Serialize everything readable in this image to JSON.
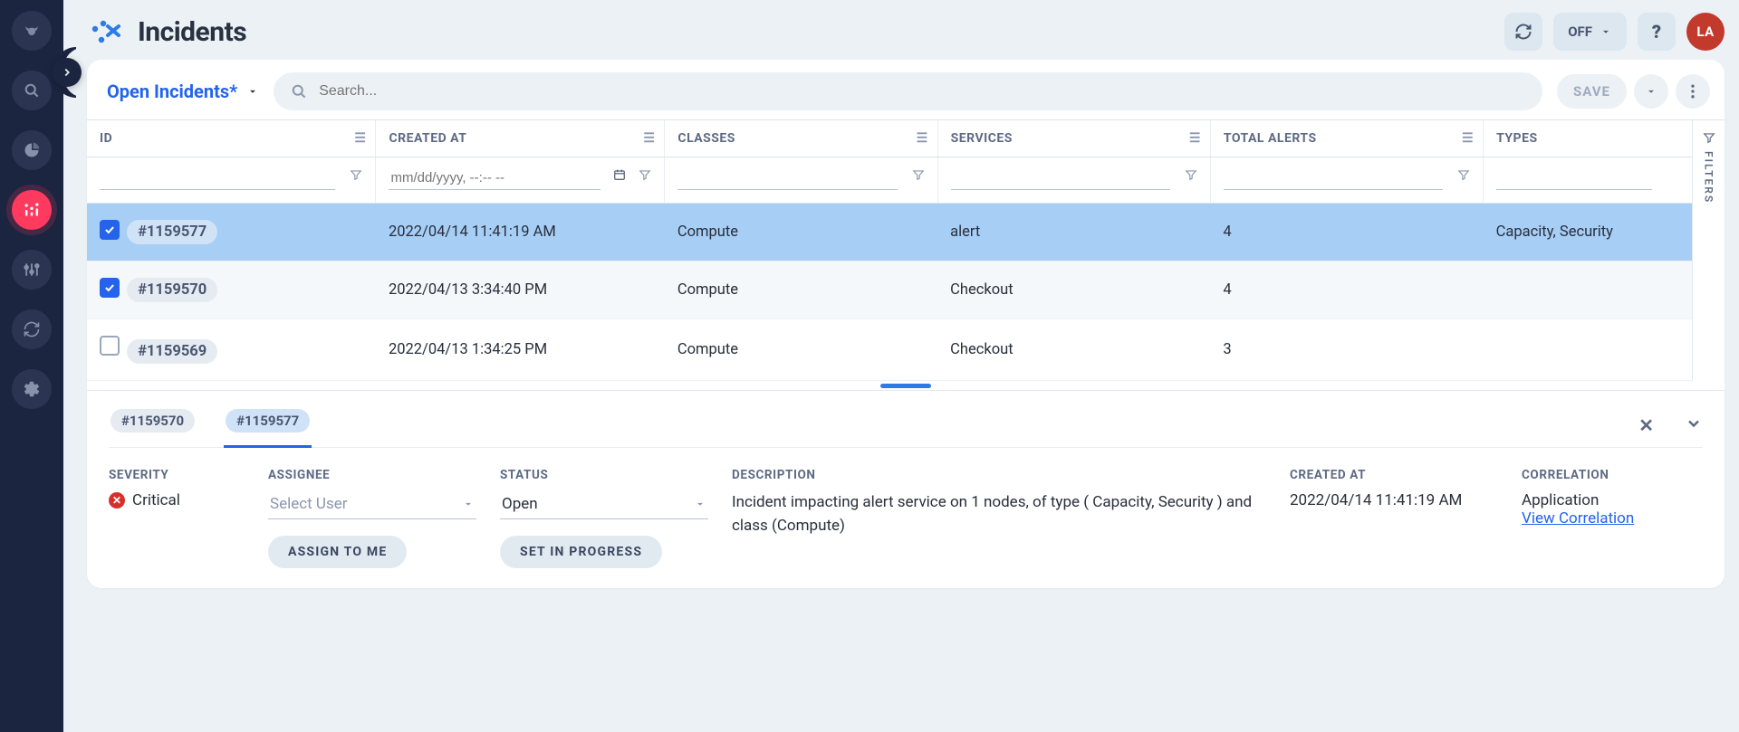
{
  "sidebar": {
    "items": [
      {
        "name": "brand",
        "icon": "bull"
      },
      {
        "name": "search",
        "icon": "magnifier"
      },
      {
        "name": "reports",
        "icon": "pie"
      },
      {
        "name": "analytics",
        "icon": "bars",
        "active": true
      },
      {
        "name": "tuning",
        "icon": "sliders"
      },
      {
        "name": "sync",
        "icon": "cycle"
      },
      {
        "name": "settings",
        "icon": "gear"
      }
    ]
  },
  "header": {
    "page_title": "Incidents",
    "refresh_icon": "refresh",
    "autorefresh_label": "OFF",
    "help_icon": "?",
    "avatar_initials": "LA"
  },
  "toolbar": {
    "view_label": "Open Incidents*",
    "search_placeholder": "Search...",
    "save_label": "SAVE"
  },
  "table": {
    "columns": [
      "ID",
      "CREATED AT",
      "CLASSES",
      "SERVICES",
      "TOTAL ALERTS",
      "TYPES"
    ],
    "date_filter_placeholder": "mm/dd/yyyy, --:-- --",
    "filters_rail_label": "FILTERS",
    "rows": [
      {
        "checked": true,
        "highlighted": true,
        "id": "#1159577",
        "created_at": "2022/04/14 11:41:19 AM",
        "classes": "Compute",
        "services": "alert",
        "total_alerts": "4",
        "types": "Capacity, Security"
      },
      {
        "checked": true,
        "highlighted": false,
        "id": "#1159570",
        "created_at": "2022/04/13 3:34:40 PM",
        "classes": "Compute",
        "services": "Checkout",
        "total_alerts": "4",
        "types": ""
      },
      {
        "checked": false,
        "highlighted": false,
        "id": "#1159569",
        "created_at": "2022/04/13 1:34:25 PM",
        "classes": "Compute",
        "services": "Checkout",
        "total_alerts": "3",
        "types": ""
      }
    ]
  },
  "detail": {
    "tabs": [
      {
        "id": "#1159570",
        "active": false
      },
      {
        "id": "#1159577",
        "active": true
      }
    ],
    "labels": {
      "severity": "SEVERITY",
      "assignee": "ASSIGNEE",
      "status": "STATUS",
      "description": "DESCRIPTION",
      "created_at": "CREATED AT",
      "correlation": "CORRELATION"
    },
    "severity_value": "Critical",
    "assignee_placeholder": "Select User",
    "assign_to_me_label": "ASSIGN TO ME",
    "status_value": "Open",
    "set_in_progress_label": "SET IN PROGRESS",
    "description_value": "Incident impacting alert service on 1 nodes, of type ( Capacity, Security ) and class (Compute)",
    "created_at_value": "2022/04/14 11:41:19 AM",
    "correlation_value": "Application",
    "correlation_link_label": "View Correlation"
  }
}
